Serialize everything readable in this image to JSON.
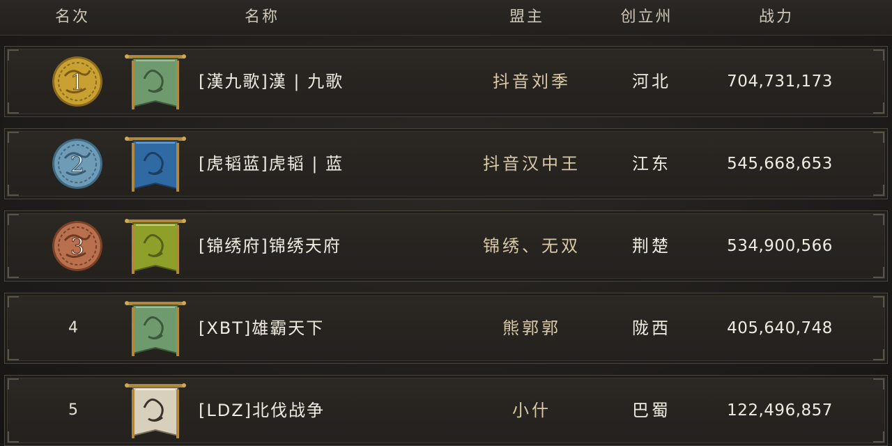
{
  "header": {
    "rank": "名次",
    "name": "名称",
    "leader": "盟主",
    "state": "创立州",
    "power": "战力"
  },
  "rows": [
    {
      "rank": "1",
      "name": "[漢九歌]漢 | 九歌",
      "leader": "抖音刘季",
      "state": "河北",
      "power": "704,731,173",
      "medal_color": "#c9a032",
      "banner_color": "#6f9a6d"
    },
    {
      "rank": "2",
      "name": "[虎韬蓝]虎韬 | 蓝",
      "leader": "抖音汉中王",
      "state": "江东",
      "power": "545,668,653",
      "medal_color": "#6f9bb6",
      "banner_color": "#2f6aa3"
    },
    {
      "rank": "3",
      "name": "[锦绣府]锦绣天府",
      "leader": "锦绣、无双",
      "state": "荆楚",
      "power": "534,900,566",
      "medal_color": "#b9704e",
      "banner_color": "#8fa02a"
    },
    {
      "rank": "4",
      "name": "[XBT]雄霸天下",
      "leader": "熊郭郭",
      "state": "陇西",
      "power": "405,640,748",
      "banner_color": "#6f9a6d"
    },
    {
      "rank": "5",
      "name": "[LDZ]北伐战争",
      "leader": "小什",
      "state": "巴蜀",
      "power": "122,496,857",
      "banner_color": "#d8cfbd"
    }
  ]
}
